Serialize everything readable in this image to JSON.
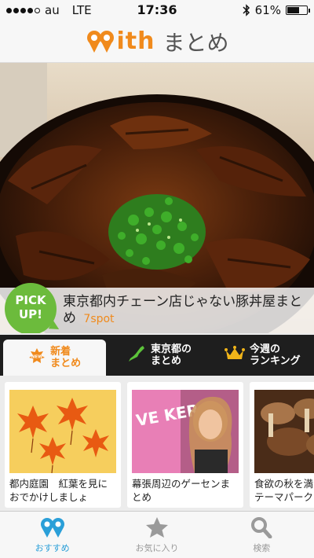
{
  "status": {
    "carrier": "au",
    "network": "LTE",
    "time": "17:36",
    "battery": "61%",
    "battery_level": 0.61,
    "signal_bars": 4
  },
  "header": {
    "logo_text": "ith",
    "logo_suffix": "まとめ",
    "brand_color": "#f08a1c"
  },
  "hero": {
    "badge_line1": "PICK",
    "badge_line2": "UP!",
    "title": "東京都内チェーン店じゃない豚丼屋まとめ",
    "spot": "7spot"
  },
  "tabs": [
    {
      "line1": "新着",
      "line2": "まとめ",
      "badge": "NEW",
      "icon": "new-badge-icon"
    },
    {
      "line1": "東京都の",
      "line2": "まとめ",
      "icon": "japan-map-icon"
    },
    {
      "line1": "今週の",
      "line2": "ランキング",
      "icon": "crown-icon"
    }
  ],
  "cards": [
    {
      "title": "都内庭園　紅葉を見に",
      "title2": "おでかけしましょ"
    },
    {
      "title": "幕張周辺のゲーセンま",
      "title2": "とめ",
      "thumb_text": "VE KER"
    },
    {
      "title": "食欲の秋を満",
      "title2": "テーマパーク"
    }
  ],
  "bottom_nav": [
    {
      "label": "おすすめ",
      "icon": "recommend-icon"
    },
    {
      "label": "お気に入り",
      "icon": "star-icon"
    },
    {
      "label": "検索",
      "icon": "search-icon"
    }
  ],
  "colors": {
    "accent": "#f08a1c",
    "active_nav": "#2a9fd8",
    "pickup": "#6cbb3c"
  }
}
